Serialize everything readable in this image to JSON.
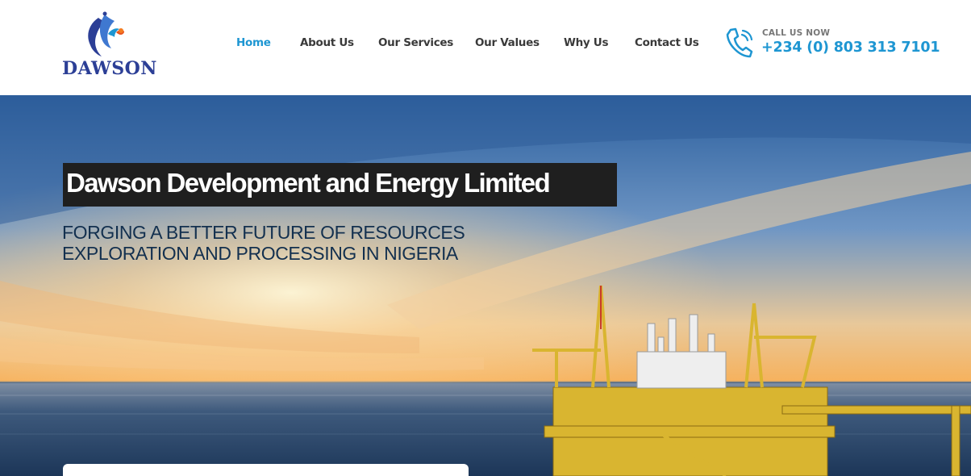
{
  "brand": {
    "name": "DAWSON"
  },
  "nav": {
    "items": [
      {
        "label": "Home",
        "active": true
      },
      {
        "label": "About Us"
      },
      {
        "label": "Our Services"
      },
      {
        "label": "Our Values"
      },
      {
        "label": "Why Us"
      },
      {
        "label": "Contact Us"
      }
    ]
  },
  "contact": {
    "label": "CALL US NOW",
    "phone": "+234 (0) 803 313 7101",
    "icon": "phone-icon"
  },
  "hero": {
    "title": "Dawson Development and Energy Limited",
    "subtitle_line1": "FORGING A BETTER FUTURE OF RESOURCES",
    "subtitle_line2": "EXPLORATION AND PROCESSING IN NIGERIA"
  },
  "colors": {
    "accent": "#1e96d2",
    "brand_blue": "#2c3f96",
    "nav_text": "#3a3a3a",
    "title_bg": "#1f1f1f",
    "subtitle": "#13304f"
  }
}
